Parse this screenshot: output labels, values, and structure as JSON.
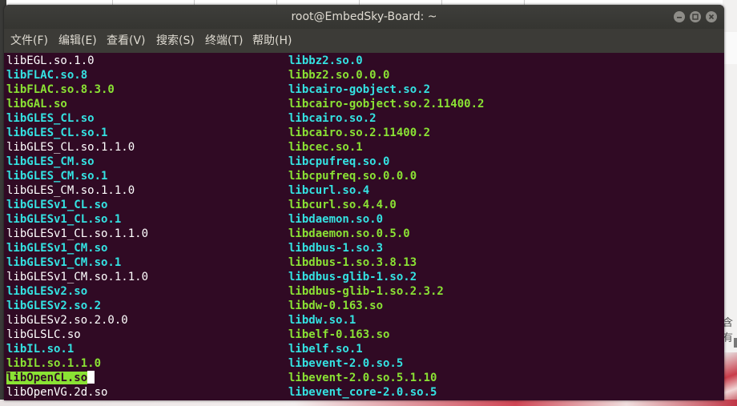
{
  "window": {
    "title": "root@EmbedSky-Board: ~"
  },
  "menu": [
    {
      "label": "文件(F)"
    },
    {
      "label": "编辑(E)"
    },
    {
      "label": "查看(V)"
    },
    {
      "label": "搜索(S)"
    },
    {
      "label": "终端(T)"
    },
    {
      "label": "帮助(H)"
    }
  ],
  "colors": {
    "terminal_bg": "#300a24",
    "plain_file": "#ffffff",
    "symlink": "#34e2e2",
    "executable": "#8ae234"
  },
  "listing": {
    "left": [
      {
        "name": "libEGL.so.1.0",
        "kind": "plain"
      },
      {
        "name": "libFLAC.so.8",
        "kind": "symlink"
      },
      {
        "name": "libFLAC.so.8.3.0",
        "kind": "executable"
      },
      {
        "name": "libGAL.so",
        "kind": "executable"
      },
      {
        "name": "libGLES_CL.so",
        "kind": "symlink"
      },
      {
        "name": "libGLES_CL.so.1",
        "kind": "symlink"
      },
      {
        "name": "libGLES_CL.so.1.1.0",
        "kind": "plain"
      },
      {
        "name": "libGLES_CM.so",
        "kind": "symlink"
      },
      {
        "name": "libGLES_CM.so.1",
        "kind": "symlink"
      },
      {
        "name": "libGLES_CM.so.1.1.0",
        "kind": "plain"
      },
      {
        "name": "libGLESv1_CL.so",
        "kind": "symlink"
      },
      {
        "name": "libGLESv1_CL.so.1",
        "kind": "symlink"
      },
      {
        "name": "libGLESv1_CL.so.1.1.0",
        "kind": "plain"
      },
      {
        "name": "libGLESv1_CM.so",
        "kind": "symlink"
      },
      {
        "name": "libGLESv1_CM.so.1",
        "kind": "symlink"
      },
      {
        "name": "libGLESv1_CM.so.1.1.0",
        "kind": "plain"
      },
      {
        "name": "libGLESv2.so",
        "kind": "symlink"
      },
      {
        "name": "libGLESv2.so.2",
        "kind": "symlink"
      },
      {
        "name": "libGLESv2.so.2.0.0",
        "kind": "plain"
      },
      {
        "name": "libGLSLC.so",
        "kind": "plain"
      },
      {
        "name": "libIL.so.1",
        "kind": "symlink"
      },
      {
        "name": "libIL.so.1.1.0",
        "kind": "executable"
      },
      {
        "name": "libOpenCL.so",
        "kind": "highlight"
      },
      {
        "name": "libOpenVG.2d.so",
        "kind": "plain"
      }
    ],
    "right": [
      {
        "name": "libbz2.so.0",
        "kind": "symlink"
      },
      {
        "name": "libbz2.so.0.0.0",
        "kind": "executable"
      },
      {
        "name": "libcairo-gobject.so.2",
        "kind": "symlink"
      },
      {
        "name": "libcairo-gobject.so.2.11400.2",
        "kind": "executable"
      },
      {
        "name": "libcairo.so.2",
        "kind": "symlink"
      },
      {
        "name": "libcairo.so.2.11400.2",
        "kind": "executable"
      },
      {
        "name": "libcec.so.1",
        "kind": "executable"
      },
      {
        "name": "libcpufreq.so.0",
        "kind": "symlink"
      },
      {
        "name": "libcpufreq.so.0.0.0",
        "kind": "executable"
      },
      {
        "name": "libcurl.so.4",
        "kind": "symlink"
      },
      {
        "name": "libcurl.so.4.4.0",
        "kind": "executable"
      },
      {
        "name": "libdaemon.so.0",
        "kind": "symlink"
      },
      {
        "name": "libdaemon.so.0.5.0",
        "kind": "executable"
      },
      {
        "name": "libdbus-1.so.3",
        "kind": "symlink"
      },
      {
        "name": "libdbus-1.so.3.8.13",
        "kind": "executable"
      },
      {
        "name": "libdbus-glib-1.so.2",
        "kind": "symlink"
      },
      {
        "name": "libdbus-glib-1.so.2.3.2",
        "kind": "executable"
      },
      {
        "name": "libdw-0.163.so",
        "kind": "executable"
      },
      {
        "name": "libdw.so.1",
        "kind": "symlink"
      },
      {
        "name": "libelf-0.163.so",
        "kind": "executable"
      },
      {
        "name": "libelf.so.1",
        "kind": "symlink"
      },
      {
        "name": "libevent-2.0.so.5",
        "kind": "symlink"
      },
      {
        "name": "libevent-2.0.so.5.1.10",
        "kind": "executable"
      },
      {
        "name": "libevent_core-2.0.so.5",
        "kind": "symlink"
      }
    ]
  },
  "background": {
    "side_text": "含有"
  }
}
